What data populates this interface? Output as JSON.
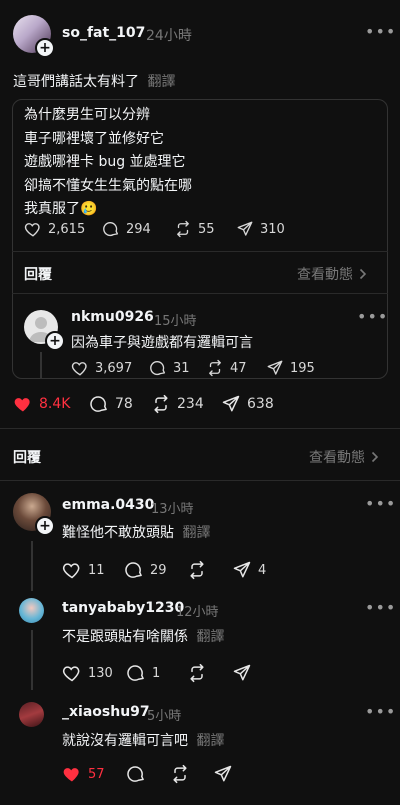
{
  "post": {
    "username": "so_fat_107",
    "time": "24小時",
    "text": "這哥們講話太有料了",
    "translate": "翻譯",
    "quote": {
      "lines": [
        "為什麼男生可以分辨",
        "車子哪裡壞了並修好它",
        "遊戲哪裡卡 bug 並處理它",
        "卻搞不懂女生生氣的點在哪",
        "我真服了🥲"
      ],
      "likes": "2,615",
      "comments": "294",
      "reposts": "55",
      "shares": "310",
      "reply_label": "回覆",
      "view_activity": "查看動態",
      "reply": {
        "username": "nkmu0926",
        "time": "15小時",
        "text": "因為車子與遊戲都有邏輯可言",
        "likes": "3,697",
        "comments": "31",
        "reposts": "47",
        "shares": "195"
      }
    },
    "likes": "8.4K",
    "comments": "78",
    "reposts": "234",
    "shares": "638"
  },
  "replies_header": {
    "label": "回覆",
    "view_activity": "查看動態"
  },
  "comments": [
    {
      "username": "emma.0430",
      "time": "13小時",
      "text": "難怪他不敢放頭貼",
      "translate": "翻譯",
      "likes": "11",
      "comments": "29",
      "shares": "4"
    },
    {
      "username": "tanyababy1230",
      "time": "12小時",
      "text": "不是跟頭貼有啥關係",
      "translate": "翻譯",
      "likes": "130",
      "comments": "1"
    },
    {
      "username": "_xiaoshu97",
      "time": "5小時",
      "text": "就說沒有邏輯可言吧",
      "translate": "翻譯",
      "likes": "57"
    }
  ],
  "colors": {
    "background": "#101010",
    "like_active": "#ff3040",
    "muted": "#777777"
  },
  "icons": [
    "heart-icon",
    "comment-icon",
    "repost-icon",
    "share-icon",
    "more-icon",
    "chevron-right-icon",
    "plus-icon"
  ]
}
